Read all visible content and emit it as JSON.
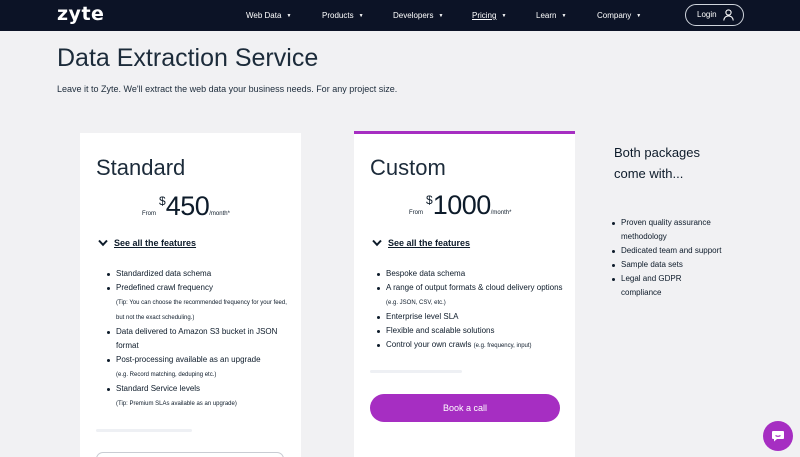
{
  "nav": {
    "logo": "zyte",
    "items": [
      {
        "label": "Web Data"
      },
      {
        "label": "Products"
      },
      {
        "label": "Developers"
      },
      {
        "label": "Pricing"
      },
      {
        "label": "Learn"
      },
      {
        "label": "Company"
      }
    ],
    "login_label": "Login"
  },
  "page": {
    "title": "Data Extraction Service",
    "subtitle": "Leave it to Zyte. We'll extract the web data your business needs. For any project size."
  },
  "standard": {
    "title": "Standard",
    "from": "From",
    "currency": "$",
    "amount": "450",
    "per": "/month*",
    "see_all": "See all the features",
    "features": [
      {
        "text": "Standardized data schema"
      },
      {
        "text": "Predefined crawl frequency",
        "tip": "(Tip: You can choose the recommended frequency for your feed, but not the exact scheduling.)"
      },
      {
        "text": "Data delivered to Amazon S3 bucket in JSON format"
      },
      {
        "text": "Post-processing available as an upgrade",
        "tip": "(e.g. Record matching, deduping etc.)"
      },
      {
        "text": "Standard Service levels",
        "tip": "(Tip: Premium SLAs available as an upgrade)"
      }
    ]
  },
  "custom": {
    "title": "Custom",
    "from": "From",
    "currency": "$",
    "amount": "1000",
    "per": "/month*",
    "see_all": "See all the features",
    "features": [
      {
        "text": "Bespoke data schema"
      },
      {
        "text": "A range of output formats & cloud delivery options",
        "tip": "(e.g. JSON, CSV, etc.)"
      },
      {
        "text": "Enterprise level SLA"
      },
      {
        "text": "Flexible and scalable solutions"
      },
      {
        "text": "Control your own crawls",
        "tip": "(e.g. frequency, input)"
      }
    ],
    "cta": "Book a call"
  },
  "side": {
    "title": "Both packages come with...",
    "items": [
      "Proven quality assurance methodology",
      "Dedicated team and support",
      "Sample data sets",
      "Legal and GDPR compliance"
    ]
  },
  "colors": {
    "nav_bg": "#0c1326",
    "accent": "#a62ec2",
    "page_bg": "#f1f1f3"
  },
  "icons": [
    "user-icon",
    "chevron-down-icon",
    "caret-down-icon",
    "chat-icon"
  ]
}
